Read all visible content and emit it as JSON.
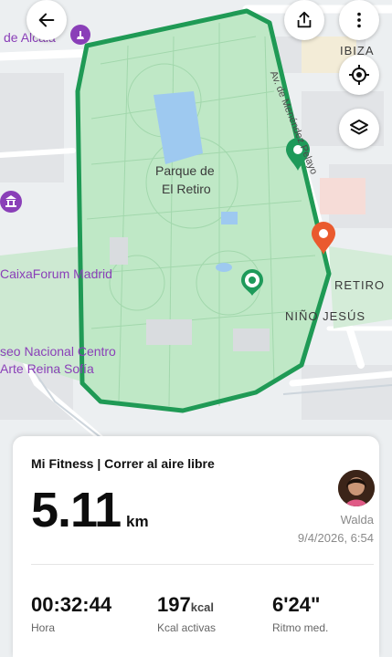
{
  "map": {
    "park_name_line1": "Parque de",
    "park_name_line2": "El Retiro",
    "labels": {
      "alcala": "de Alcalá",
      "ibiza": "IBIZA",
      "street": "Av. de Menéndez Pelayo",
      "caixaforum": "CaixaForum Madrid",
      "retiro": "RETIRO",
      "nino_jesus": "NIÑO JESÚS",
      "museo_line1": "seo Nacional Centro",
      "museo_line2": "Arte Reina Sofía"
    },
    "colors": {
      "park_fill": "#bfe8c6",
      "route": "#1f9a55",
      "start_pin": "#1e9a5a",
      "end_pin": "#ea5a2e",
      "poi": "#8a3fb8"
    }
  },
  "toolbar": {
    "back_icon": "arrow-left-icon",
    "share_icon": "share-icon",
    "more_icon": "more-vertical-icon",
    "locate_icon": "locate-icon",
    "layers_icon": "layers-icon"
  },
  "activity": {
    "title": "Mi Fitness | Correr al aire libre",
    "distance": "5.11",
    "distance_unit": "km",
    "user_name": "Walda",
    "date": "9/4/2026, 6:54",
    "stats": [
      {
        "value": "00:32:44",
        "unit": "",
        "label": "Hora"
      },
      {
        "value": "197",
        "unit": "kcal",
        "label": "Kcal activas"
      },
      {
        "value": "6'24\"",
        "unit": "",
        "label": "Ritmo med."
      }
    ]
  }
}
